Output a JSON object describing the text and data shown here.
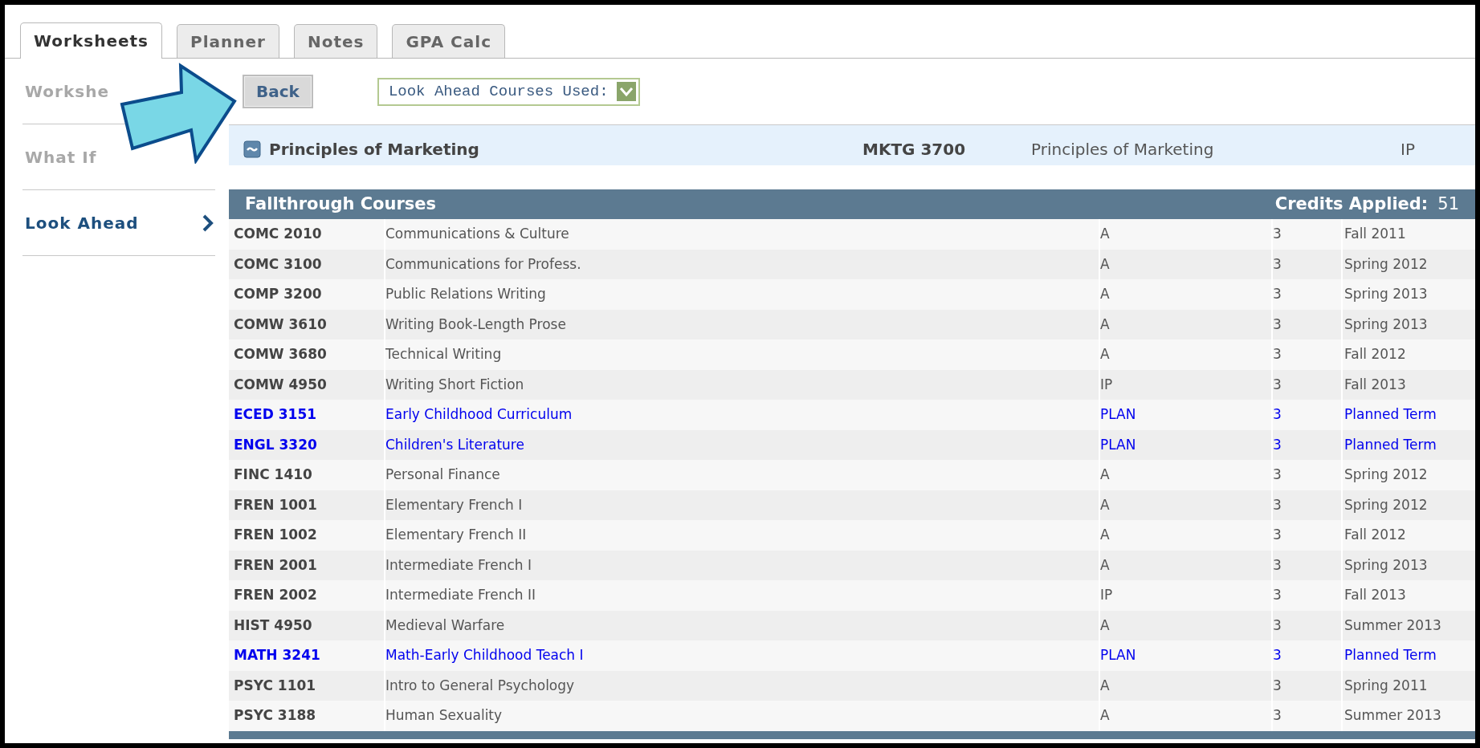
{
  "tabs": [
    {
      "label": "Worksheets",
      "selected": true
    },
    {
      "label": "Planner",
      "selected": false
    },
    {
      "label": "Notes",
      "selected": false
    },
    {
      "label": "GPA Calc",
      "selected": false
    }
  ],
  "sidebar": {
    "items": [
      {
        "label": "Workshe",
        "selected": false
      },
      {
        "label": "What If",
        "selected": false
      },
      {
        "label": "Look Ahead",
        "selected": true
      }
    ]
  },
  "toolbar": {
    "back_button": "Back",
    "select": {
      "value": "Look Ahead Courses Used:"
    }
  },
  "requirement_row": {
    "title": "Principles of Marketing",
    "course": "MKTG 3700",
    "course_title": "Principles of Marketing",
    "grade": "IP"
  },
  "fallthrough": {
    "title": "Fallthrough Courses",
    "credits_label": "Credits Applied:",
    "credits_value": "51",
    "rows": [
      {
        "code": "COMC 2010",
        "title": "Communications & Culture",
        "grade": "A",
        "credits": "3",
        "term": "Fall 2011",
        "planned": false
      },
      {
        "code": "COMC 3100",
        "title": "Communications for Profess.",
        "grade": "A",
        "credits": "3",
        "term": "Spring 2012",
        "planned": false
      },
      {
        "code": "COMP 3200",
        "title": "Public Relations Writing",
        "grade": "A",
        "credits": "3",
        "term": "Spring 2013",
        "planned": false
      },
      {
        "code": "COMW 3610",
        "title": "Writing Book-Length Prose",
        "grade": "A",
        "credits": "3",
        "term": "Spring 2013",
        "planned": false
      },
      {
        "code": "COMW 3680",
        "title": "Technical Writing",
        "grade": "A",
        "credits": "3",
        "term": "Fall 2012",
        "planned": false
      },
      {
        "code": "COMW 4950",
        "title": "Writing Short Fiction",
        "grade": "IP",
        "credits": "3",
        "term": "Fall 2013",
        "planned": false
      },
      {
        "code": "ECED 3151",
        "title": "Early Childhood Curriculum",
        "grade": "PLAN",
        "credits": "3",
        "term": "Planned Term",
        "planned": true
      },
      {
        "code": "ENGL 3320",
        "title": "Children's Literature",
        "grade": "PLAN",
        "credits": "3",
        "term": "Planned Term",
        "planned": true
      },
      {
        "code": "FINC 1410",
        "title": "Personal Finance",
        "grade": "A",
        "credits": "3",
        "term": "Spring 2012",
        "planned": false
      },
      {
        "code": "FREN 1001",
        "title": "Elementary French I",
        "grade": "A",
        "credits": "3",
        "term": "Spring 2012",
        "planned": false
      },
      {
        "code": "FREN 1002",
        "title": "Elementary French II",
        "grade": "A",
        "credits": "3",
        "term": "Fall 2012",
        "planned": false
      },
      {
        "code": "FREN 2001",
        "title": "Intermediate French I",
        "grade": "A",
        "credits": "3",
        "term": "Spring 2013",
        "planned": false
      },
      {
        "code": "FREN 2002",
        "title": "Intermediate French II",
        "grade": "IP",
        "credits": "3",
        "term": "Fall 2013",
        "planned": false
      },
      {
        "code": "HIST 4950",
        "title": "Medieval Warfare",
        "grade": "A",
        "credits": "3",
        "term": "Summer 2013",
        "planned": false
      },
      {
        "code": "MATH 3241",
        "title": "Math-Early Childhood Teach I",
        "grade": "PLAN",
        "credits": "3",
        "term": "Planned Term",
        "planned": true
      },
      {
        "code": "PSYC 1101",
        "title": "Intro to General Psychology",
        "grade": "A",
        "credits": "3",
        "term": "Spring 2011",
        "planned": false
      },
      {
        "code": "PSYC 3188",
        "title": "Human Sexuality",
        "grade": "A",
        "credits": "3",
        "term": "Summer 2013",
        "planned": false
      }
    ]
  }
}
